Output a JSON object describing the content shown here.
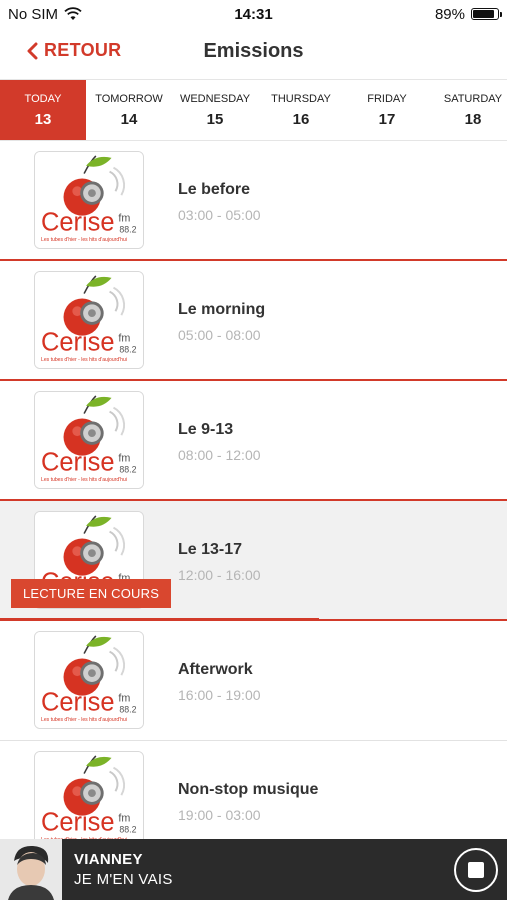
{
  "status_bar": {
    "carrier": "No SIM",
    "time": "14:31",
    "battery": "89%",
    "battery_level": 0.89
  },
  "header": {
    "back_label": "RETOUR",
    "title": "Emissions"
  },
  "days": [
    {
      "name": "TODAY",
      "num": "13",
      "active": true
    },
    {
      "name": "TOMORROW",
      "num": "14"
    },
    {
      "name": "WEDNESDAY",
      "num": "15"
    },
    {
      "name": "THURSDAY",
      "num": "16"
    },
    {
      "name": "FRIDAY",
      "num": "17"
    },
    {
      "name": "SATURDAY",
      "num": "18"
    }
  ],
  "logo": {
    "brand": "Cerise",
    "suffix": "fm",
    "freq": "88.2",
    "tagline": "Les tubes d'hier - les hits d'aujourd'hui"
  },
  "shows": [
    {
      "title": "Le before",
      "time": "03:00 - 05:00"
    },
    {
      "title": "Le morning",
      "time": "05:00 - 08:00"
    },
    {
      "title": "Le 9-13",
      "time": "08:00 - 12:00"
    },
    {
      "title": "Le 13-17",
      "time": "12:00 - 16:00",
      "current": true
    },
    {
      "title": "Afterwork",
      "time": "16:00 - 19:00"
    },
    {
      "title": "Non-stop musique",
      "time": "19:00 - 03:00"
    }
  ],
  "now_playing_badge": "LECTURE EN COURS",
  "current_progress": 0.63,
  "player": {
    "artist": "VIANNEY",
    "track": "JE M'EN VAIS"
  },
  "colors": {
    "accent": "#d23a2a",
    "player_bg": "#2b2b2b"
  }
}
